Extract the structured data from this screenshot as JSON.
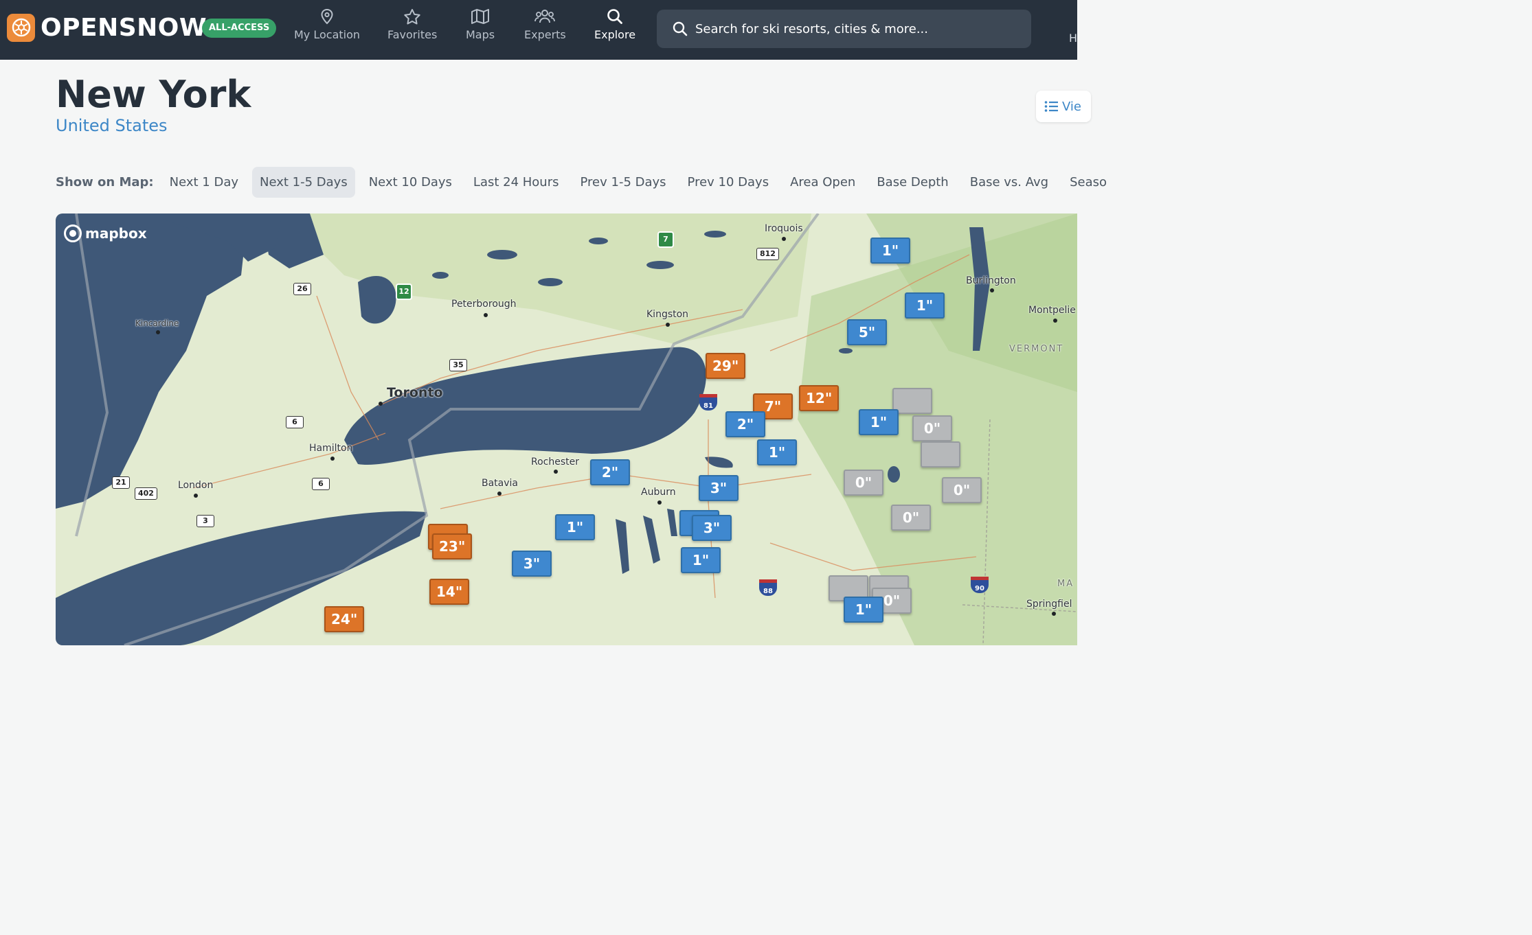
{
  "header": {
    "logo_text": "OPENSNOW",
    "badge": "ALL-ACCESS",
    "nav": [
      {
        "label": "My Location",
        "icon": "location-pin-icon"
      },
      {
        "label": "Favorites",
        "icon": "star-icon"
      },
      {
        "label": "Maps",
        "icon": "map-icon"
      },
      {
        "label": "Experts",
        "icon": "people-icon"
      },
      {
        "label": "Explore",
        "icon": "search-icon"
      }
    ],
    "search_placeholder": "Search for ski resorts, cities & more...",
    "cut_text": "H"
  },
  "page": {
    "title": "New York",
    "subtitle": "United States",
    "view_button": "Vie"
  },
  "tabs": {
    "label": "Show on Map:",
    "items": [
      "Next 1 Day",
      "Next 1-5 Days",
      "Next 10 Days",
      "Last 24 Hours",
      "Prev 1-5 Days",
      "Prev 10 Days",
      "Area Open",
      "Base Depth",
      "Base vs. Avg",
      "Seaso"
    ],
    "active_index": 1
  },
  "map": {
    "attribution": "mapbox",
    "places": {
      "toronto": "Toronto",
      "peterborough": "Peterborough",
      "kingston": "Kingston",
      "iroquois": "Iroquois",
      "burlington": "Burlington",
      "montpelier": "Montpelie",
      "vermont": "VERMONT",
      "kincardine": "Kincardine",
      "hamilton": "Hamilton",
      "london": "London",
      "rochester": "Rochester",
      "batavia": "Batavia",
      "auburn": "Auburn",
      "springfield": "Springfiel",
      "ma": "MA"
    },
    "shields": {
      "r26": "26",
      "r12": "12",
      "r35": "35",
      "r6a": "6",
      "r6b": "6",
      "r21": "21",
      "r402": "402",
      "r3": "3",
      "r812": "812",
      "r7": "7",
      "i81": "81",
      "i88": "88",
      "i90": "90"
    },
    "markers": {
      "m1": "1\"",
      "m2": "1\"",
      "m3": "5\"",
      "m4": "29\"",
      "m5": "12\"",
      "m6": "7\"",
      "m7": "2\"",
      "m8": "1\"",
      "m9": "0\"",
      "m10": "1\"",
      "m11": "2\"",
      "m12": "0\"",
      "m13": "3\"",
      "m14": "0\"",
      "m15": "0\"",
      "m16": "3\"",
      "m17": "1\"",
      "m18": "23\"",
      "m19": "3\"",
      "m20": "1\"",
      "m21": "14\"",
      "m22": "24\"",
      "m23": "0\"",
      "m24": "1\""
    }
  }
}
